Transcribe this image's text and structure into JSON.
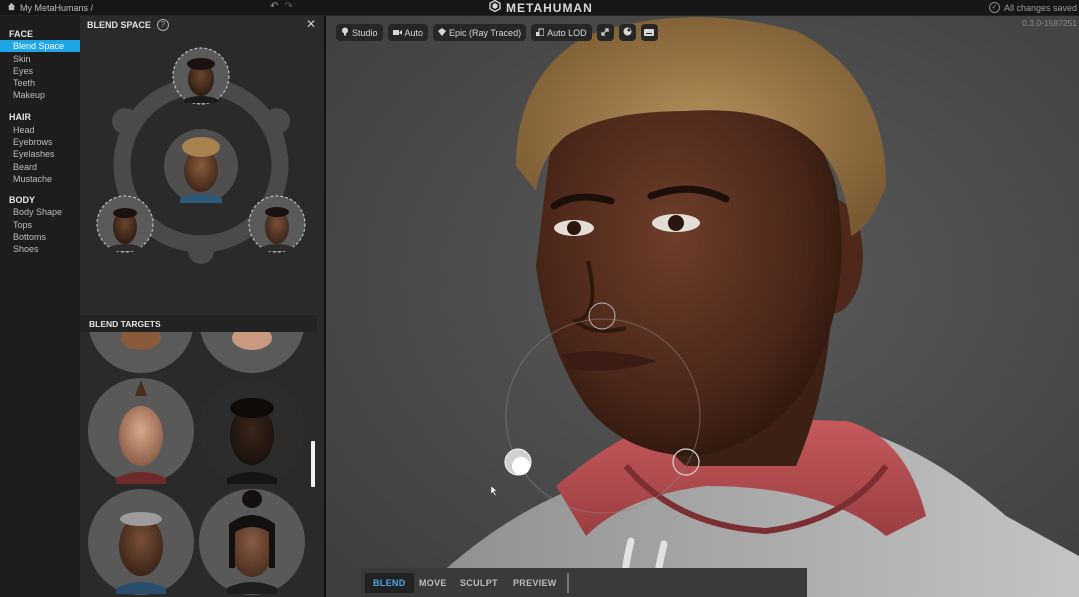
{
  "topbar": {
    "breadcrumb": "My MetaHumans /",
    "app_name": "METAHUMAN",
    "save_status": "All changes saved"
  },
  "nav": {
    "sections": [
      {
        "title": "FACE",
        "items": [
          "Blend Space",
          "Skin",
          "Eyes",
          "Teeth",
          "Makeup"
        ]
      },
      {
        "title": "HAIR",
        "items": [
          "Head",
          "Eyebrows",
          "Eyelashes",
          "Beard",
          "Mustache"
        ]
      },
      {
        "title": "BODY",
        "items": [
          "Body Shape",
          "Tops",
          "Bottoms",
          "Shoes"
        ]
      }
    ],
    "active_item": "Blend Space"
  },
  "panel": {
    "title": "BLEND SPACE",
    "targets_title": "BLEND TARGETS"
  },
  "viewport": {
    "toolbar": {
      "lighting": "Studio",
      "camera": "Auto",
      "render": "Epic (Ray Traced)",
      "lod": "Auto LOD"
    },
    "version": "0.3.0-1587251",
    "modes": [
      "BLEND",
      "MOVE",
      "SCULPT",
      "PREVIEW"
    ],
    "active_mode": "BLEND"
  },
  "colors": {
    "accent": "#1ea5e8",
    "mode_active": "#4aa8e6",
    "hoodie": "#c25356",
    "hair": "#a7824e"
  },
  "icons": [
    "home-icon",
    "undo-icon",
    "redo-icon",
    "metahuman-logo-icon",
    "check-circle-icon",
    "help-icon",
    "close-icon",
    "light-icon",
    "camera-icon",
    "render-icon",
    "lod-icon",
    "transform-icon",
    "sphere-icon",
    "keyboard-icon"
  ]
}
